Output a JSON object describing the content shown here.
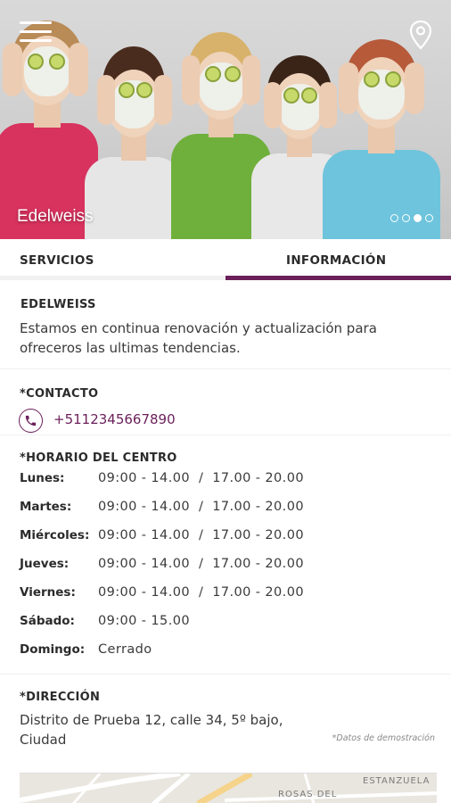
{
  "hero": {
    "title": "Edelweiss",
    "menu_icon": "hamburger-menu-icon",
    "location_icon": "map-pin-icon",
    "carousel": {
      "total": 4,
      "active_index": 2
    }
  },
  "tabs": [
    {
      "label": "SERVICIOS",
      "active": false
    },
    {
      "label": "INFORMACIÓN",
      "active": true
    }
  ],
  "about": {
    "heading": "EDELWEISS",
    "text": "Estamos en continua renovación y actualización para ofreceros las ultimas tendencias."
  },
  "contact": {
    "heading": "*CONTACTO",
    "phone_icon": "phone-icon",
    "phone": "+5112345667890"
  },
  "hours": {
    "heading": "*HORARIO DEL CENTRO",
    "rows": [
      {
        "day": "Lunes:",
        "time": "09:00 - 14.00  /  17.00 - 20.00"
      },
      {
        "day": "Martes:",
        "time": "09:00 - 14.00  /  17.00 - 20.00"
      },
      {
        "day": "Miércoles:",
        "time": "09:00 - 14.00  /  17.00 - 20.00"
      },
      {
        "day": "Jueves:",
        "time": "09:00 - 14.00  /  17.00 - 20.00"
      },
      {
        "day": "Viernes:",
        "time": "09:00 - 14.00  /  17.00 - 20.00"
      },
      {
        "day": "Sábado:",
        "time": "09:00 - 15.00"
      },
      {
        "day": "Domingo:",
        "time": "Cerrado"
      }
    ]
  },
  "address": {
    "heading": "*DIRECCIÓN",
    "text": "Distrito de Prueba 12, calle 34, 5º bajo, Ciudad",
    "note": "*Datos de demostración"
  },
  "map": {
    "labels": [
      "ROSAS DEL",
      "ESTANZUELA"
    ]
  },
  "colors": {
    "accent": "#6b1f5a"
  }
}
